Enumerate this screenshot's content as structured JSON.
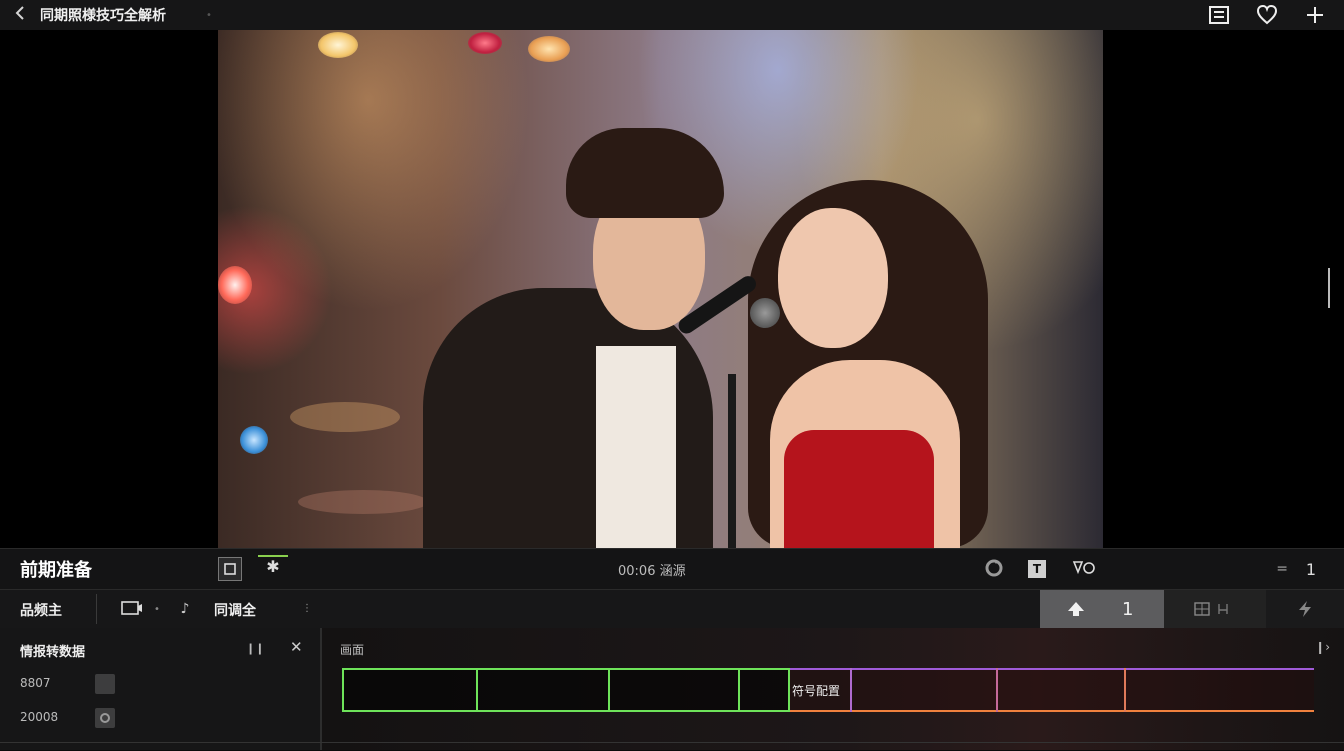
{
  "topbar": {
    "back_icon": "chevron-left-icon",
    "title": "同期照様技巧全解析",
    "icons": [
      "layout-icon",
      "heart-icon",
      "plus-icon"
    ]
  },
  "section": {
    "title": "前期准备",
    "center_label": "00:06 涵源",
    "count_eq": "=",
    "count": "1"
  },
  "toolrow": {
    "item1": "品频主",
    "item2": "同调全",
    "count": "1",
    "selected_icon": "upload-icon"
  },
  "left_panel": {
    "title": "情报转数据",
    "rows": [
      {
        "label": "8807"
      },
      {
        "label": "20008"
      }
    ]
  },
  "timeline": {
    "label": "画面",
    "clip_label": "符号配置",
    "colors": {
      "green": "#6ee35a",
      "purple": "#a05bd8",
      "orange": "#f0813e"
    }
  }
}
